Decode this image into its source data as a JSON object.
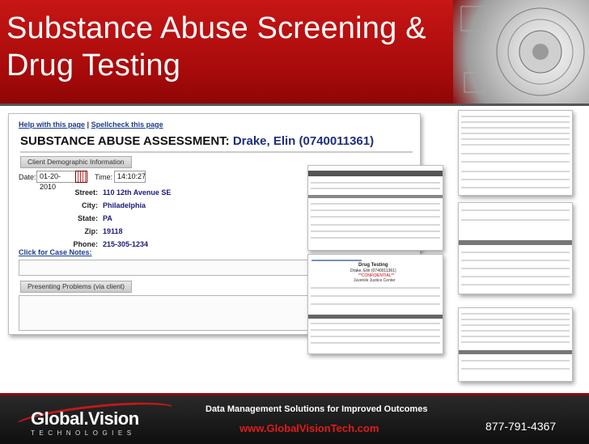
{
  "slide": {
    "title_line1": "Substance Abuse Screening &",
    "title_line2": "Drug Testing",
    "accent_color": "#b30d0d"
  },
  "main_screenshot": {
    "help_link": "Help with this page",
    "separator": "|",
    "spellcheck_link": "Spellcheck this page",
    "form_title": "SUBSTANCE ABUSE ASSESSMENT:",
    "client_name": "Drake, Elin (0740011361)",
    "demographic_tab": "Client Demographic Information",
    "date_label": "Date:",
    "date_value": "01-20-2010",
    "calendar_icon": "calendar-icon",
    "time_label": "Time:",
    "time_value": "14:10:27",
    "street_label": "Street:",
    "street_value": "110 12th Avenue SE",
    "city_label": "City:",
    "city_value": "Philadelphia",
    "state_label": "State:",
    "state_value": "PA",
    "zip_label": "Zip:",
    "zip_value": "19118",
    "phone_label": "Phone:",
    "phone_value": "215-305-1234",
    "case_notes_link": "Click for Case Notes:",
    "presenting_problems_tab": "Presenting Problems (via client)"
  },
  "drug_testing_screenshot": {
    "title": "Drug Testing",
    "client": "Drake, Elin (0740011361)",
    "flag": "**CONFIDENTIAL**",
    "center": "Juvenile Justice Center"
  },
  "footer": {
    "logo_name": "Global.Vision",
    "logo_sub": "TECHNOLOGIES",
    "tagline": "Data Management Solutions for Improved Outcomes",
    "url": "www.GlobalVisionTech.com",
    "phone": "877-791-4367"
  }
}
